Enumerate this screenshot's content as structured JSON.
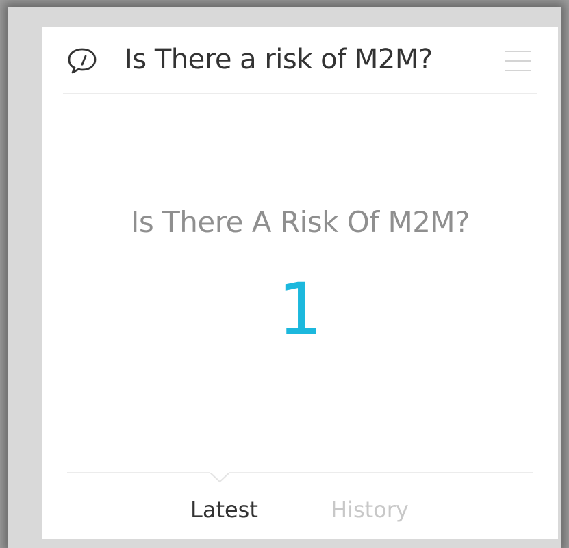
{
  "widget": {
    "icon": "speech-gauge-icon",
    "title": "Is There a risk of M2M?",
    "menu_icon": "hamburger-menu-icon"
  },
  "metric": {
    "label": "Is There A Risk Of M2M?",
    "value": "1",
    "value_color": "#1cb8dd"
  },
  "tabs": [
    {
      "label": "Latest",
      "active": true
    },
    {
      "label": "History",
      "active": false
    }
  ]
}
